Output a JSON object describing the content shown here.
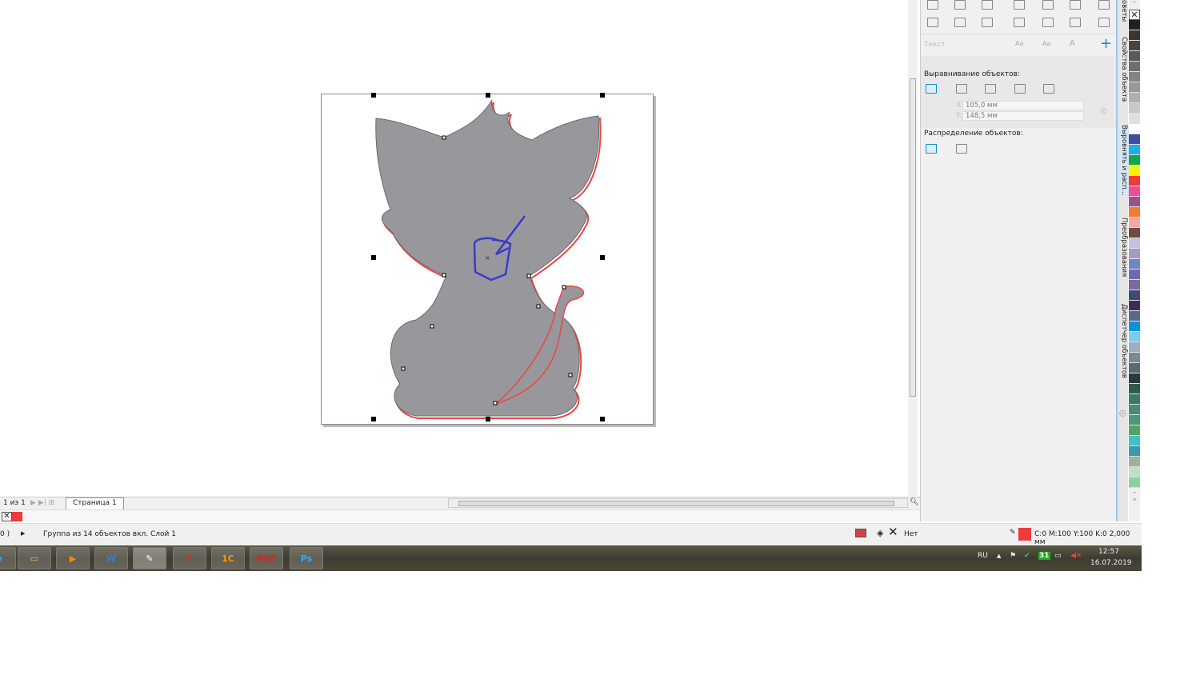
{
  "docker": {
    "text_label": "Текст",
    "align_title": "Выравнивание объектов:",
    "x_label": "X:",
    "x_value": "105,0 мм",
    "y_label": "Y:",
    "y_value": "148,5 мм",
    "distribute_title": "Распределение объектов:"
  },
  "side_tabs": [
    "оветы",
    "Свойства объекта",
    "Выровнять и расп...",
    "Преобразования",
    "Диспетчер объектов"
  ],
  "palette": [
    "#231f20",
    "#3d3530",
    "#4a4440",
    "#5a5a5a",
    "#6e6e6e",
    "#848484",
    "#999999",
    "#b0b0b0",
    "#c8c8c8",
    "#e0e0e0",
    "#ffffff",
    "#3f4ea0",
    "#1ab0e8",
    "#12a650",
    "#fff200",
    "#ee3a3a",
    "#ec4f9a",
    "#9e4f8c",
    "#f47c30",
    "#f9a7a8",
    "#6e4e42",
    "#c7c0e0",
    "#a39ac8",
    "#6f86c6",
    "#6e6aae",
    "#7a6a9e",
    "#3f4a78",
    "#3a2f52",
    "#5a6a8a",
    "#0a94d8",
    "#7ccaf0",
    "#9ab0c0",
    "#7a8a94",
    "#5a6a70",
    "#2a3a3a",
    "#2f5a50",
    "#3a7a68",
    "#4a8a78",
    "#4a9a7a",
    "#5aa060",
    "#40c0c8",
    "#3a9aa8",
    "#a0b0a0",
    "#c0e0c8",
    "#90d0a0"
  ],
  "pagebar": {
    "counter": "1 из 1",
    "page_tab": "Страница 1"
  },
  "status": {
    "left_fragment": "0 )",
    "selection": "Группа из 14 объектов вкл. Слой 1",
    "fill": "Нет",
    "outline": "C:0 M:100 Y:100 K:0  2,000 мм",
    "outline_color": "#ee3a3a"
  },
  "taskbar": {
    "apps": [
      "IE",
      "Explorer",
      "Media Player",
      "Word",
      "CorelDRAW",
      "Yandex",
      "1C",
      "PDF",
      "Photoshop"
    ],
    "lang": "RU",
    "calendar": "31",
    "time": "12:57",
    "date": "16.07.2019"
  }
}
